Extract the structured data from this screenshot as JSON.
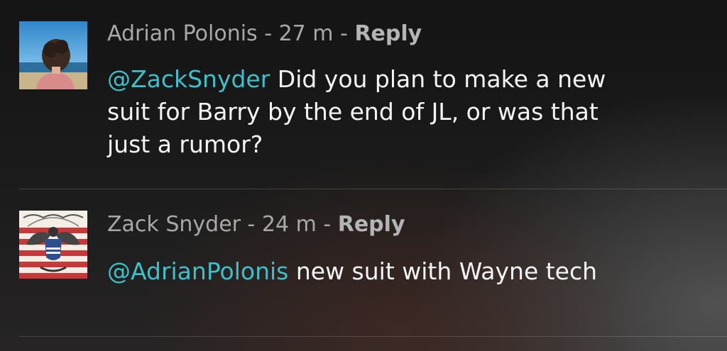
{
  "comments": [
    {
      "author": "Adrian Polonis",
      "separator": " - ",
      "time": "27 m",
      "separator2": " - ",
      "reply_label": "Reply",
      "mention": "@ZackSnyder",
      "text": " Did you plan to make a new suit for Barry by the end of JL, or was that just a rumor?",
      "avatar_icon": "person-at-beach-avatar"
    },
    {
      "author": "Zack Snyder",
      "separator": " - ",
      "time": "24 m",
      "separator2": " - ",
      "reply_label": "Reply",
      "mention": "@AdrianPolonis",
      "text": " new suit with Wayne tech",
      "avatar_icon": "eagle-flag-avatar"
    }
  ],
  "colors": {
    "mention": "#3dc0c8",
    "meta": "#a8a8a8",
    "text": "#f4f4f4"
  }
}
